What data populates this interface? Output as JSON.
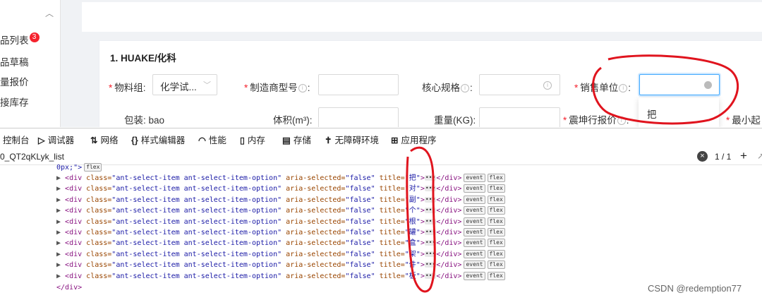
{
  "sidebar": {
    "items": [
      {
        "label": "品列表",
        "badge": "3"
      },
      {
        "label": "品草稿"
      },
      {
        "label": "量报价"
      },
      {
        "label": "接库存"
      }
    ]
  },
  "card": {
    "title": "1. HUAKE/化科",
    "fields": {
      "material_group": {
        "label": "物料组:",
        "value": "化学试..."
      },
      "model": {
        "label": "制造商型号",
        "colon": ":"
      },
      "spec": {
        "label": "核心规格",
        "colon": ":"
      },
      "sales_unit": {
        "label": "销售单位",
        "colon": ":"
      },
      "packaging": {
        "label": "包装: bao"
      },
      "volume": {
        "label": "体积(m³):"
      },
      "weight": {
        "label": "重量(KG):"
      },
      "quote": {
        "label": "震坤行报价",
        "colon": ":"
      },
      "min_order": {
        "label": "最小起"
      }
    },
    "dropdown_option": "把"
  },
  "devtools": {
    "tabs": [
      {
        "icon": "console-icon",
        "label": "控制台"
      },
      {
        "icon": "debugger-icon",
        "label": "调试器"
      },
      {
        "icon": "network-icon",
        "label": "网络"
      },
      {
        "icon": "style-editor-icon",
        "label": "样式编辑器"
      },
      {
        "icon": "performance-icon",
        "label": "性能"
      },
      {
        "icon": "memory-icon",
        "label": "内存"
      },
      {
        "icon": "storage-icon",
        "label": "存储"
      },
      {
        "icon": "accessibility-icon",
        "label": "无障碍环境"
      },
      {
        "icon": "app-icon",
        "label": "应用程序"
      }
    ],
    "search": {
      "value": "0_QT2qKLyk_list",
      "count": "1 / 1"
    }
  },
  "code": {
    "first_line": "0px;\">",
    "first_pill": "flex",
    "tag_open": "<div",
    "class_attr": "class=",
    "class_value": "\"ant-select-item ant-select-item-option\"",
    "aria_attr": "aria-selected=",
    "aria_value": "\"false\"",
    "title_attr": "title=",
    "close_tag": "</div>",
    "pill_event": "event",
    "pill_flex": "flex",
    "titles": [
      "把",
      "对",
      "副",
      "个",
      "根",
      "罐",
      "盒",
      "架",
      "件",
      "板"
    ],
    "last_close": "</div>"
  },
  "watermark": "CSDN @redemption77"
}
